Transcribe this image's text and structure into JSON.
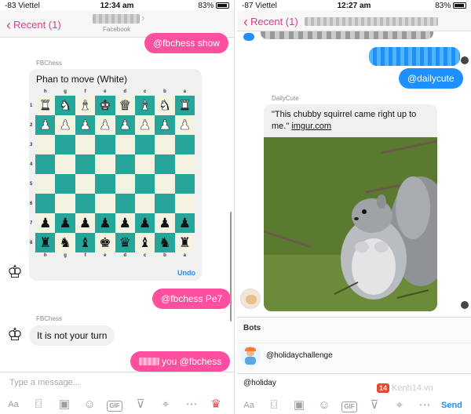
{
  "left": {
    "status": {
      "carrier": "-83 Viettel",
      "time": "12:34 am",
      "battery": "83%"
    },
    "nav": {
      "back_label": "Recent (1)",
      "subtitle": "Facebook"
    },
    "messages": {
      "out_show": "@fbchess show",
      "sender_1": "FBChess",
      "board_title": "Phan to move (White)",
      "undo": "Undo",
      "out_move": "@fbchess Pe7",
      "sender_2": "FBChess",
      "in_turn": "It is not your turn",
      "out_you": "you @fbchess"
    },
    "board": {
      "files": [
        "h",
        "g",
        "f",
        "e",
        "d",
        "c",
        "b",
        "a"
      ],
      "ranks": [
        "1",
        "2",
        "3",
        "4",
        "5",
        "6",
        "7",
        "8"
      ],
      "rows": [
        [
          "♜",
          "♞",
          "♝",
          "♚",
          "♛",
          "♝",
          "♞",
          "♜"
        ],
        [
          "♟",
          "♟",
          "♟",
          "♟",
          "♟",
          "♟",
          "♟",
          "♟"
        ],
        [
          "",
          "",
          "",
          "",
          "",
          "",
          "",
          ""
        ],
        [
          "",
          "",
          "",
          "",
          "",
          "",
          "",
          ""
        ],
        [
          "",
          "",
          "",
          "",
          "",
          "",
          "",
          ""
        ],
        [
          "",
          "",
          "",
          "",
          "",
          "",
          "",
          ""
        ],
        [
          "♟",
          "♟",
          "♟",
          "♟",
          "♟",
          "♟",
          "♟",
          "♟"
        ],
        [
          "♜",
          "♞",
          "♝",
          "♚",
          "♛",
          "♝",
          "♞",
          "♜"
        ]
      ],
      "row_colors": [
        "white",
        "white",
        "",
        "",
        "",
        "",
        "black",
        "black"
      ]
    },
    "input_placeholder": "Type a message..."
  },
  "right": {
    "status": {
      "carrier": "-87 Viettel",
      "time": "12:27 am",
      "battery": "83%"
    },
    "nav": {
      "back_label": "Recent (1)"
    },
    "messages": {
      "out_dailycute": "@dailycute",
      "sender": "DailyCute",
      "caption": "\"This chubby squirrel came right up to me.\"",
      "link": "imgur.com"
    },
    "bots": {
      "title": "Bots",
      "item": "@holidaychallenge"
    },
    "input_value": "@holiday",
    "send": "Send",
    "watermark": {
      "badge": "14",
      "text": "Kenh14.vn"
    }
  },
  "colors": {
    "accent_pink": "#ff4f9e",
    "accent_blue": "#1e90ff",
    "board_dark": "#26a69a",
    "board_light": "#f3f1df"
  },
  "toolbar_icons": [
    "aa-icon",
    "camera-icon",
    "photo-icon",
    "emoji-icon",
    "gif-icon",
    "mic-icon",
    "location-icon",
    "more-icon",
    "like-icon"
  ]
}
